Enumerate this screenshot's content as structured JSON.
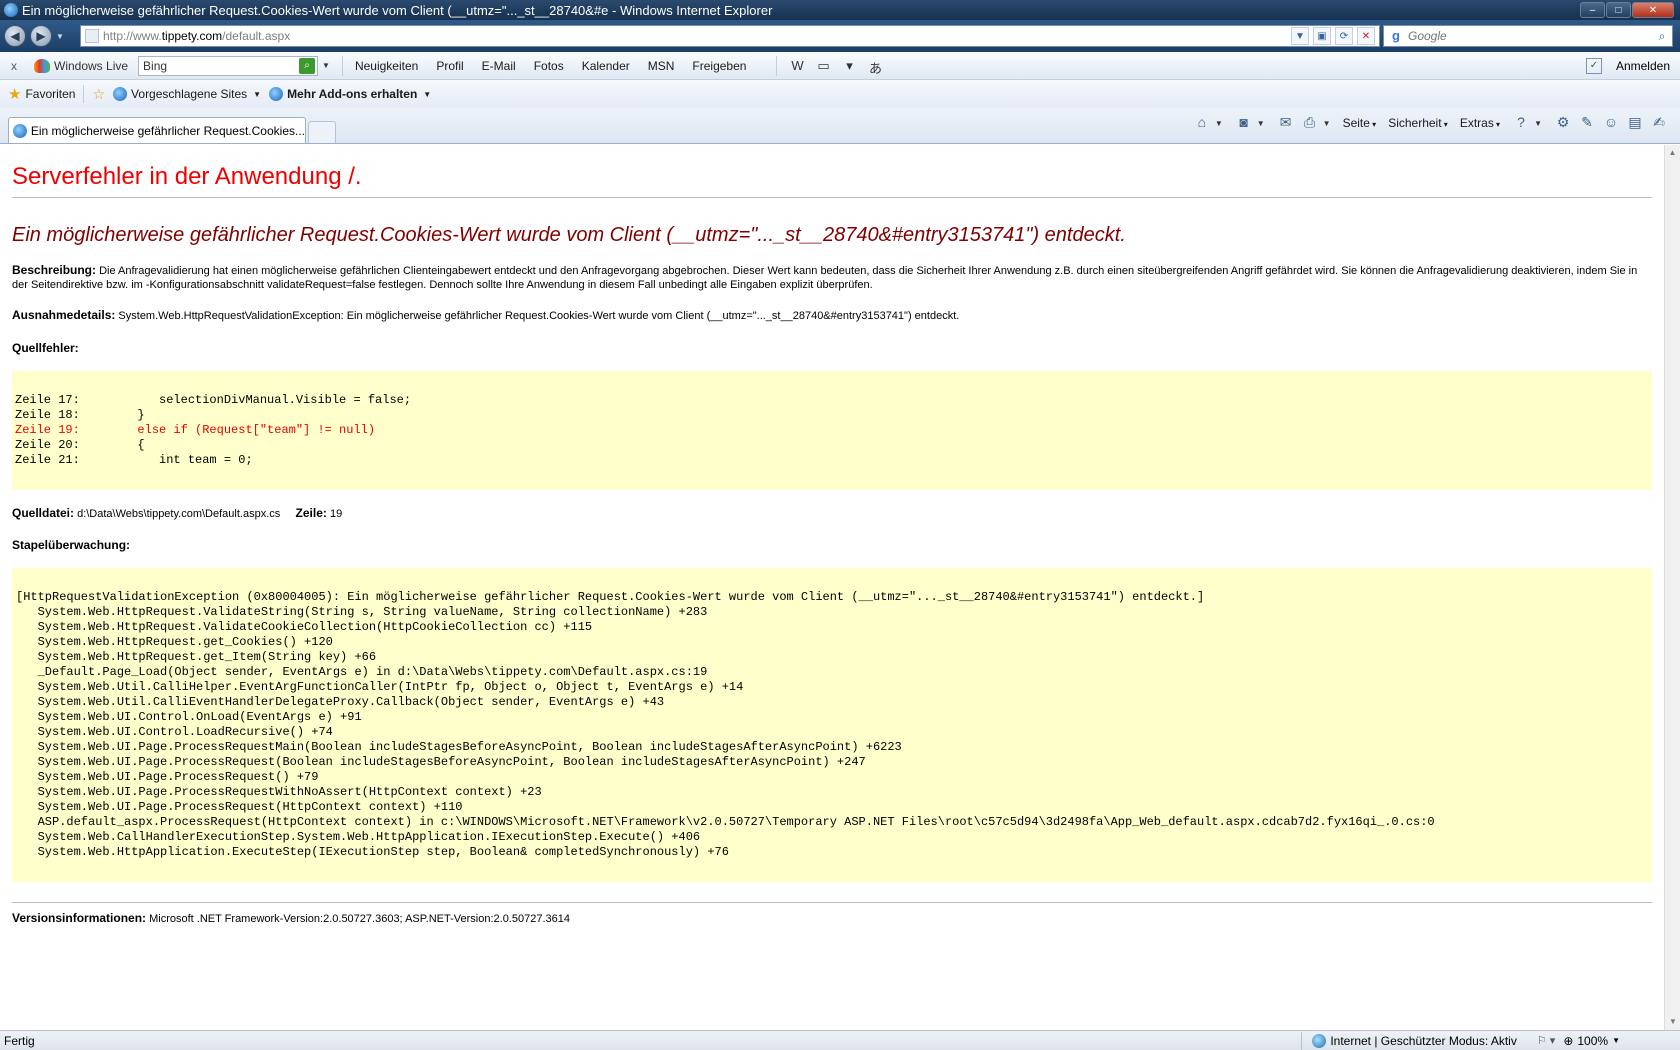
{
  "window": {
    "title": "Ein möglicherweise gefährlicher Request.Cookies-Wert wurde vom Client (__utmz=\"..._st__28740&#e - Windows Internet Explorer",
    "minimize": "–",
    "maximize": "□",
    "close": "✕"
  },
  "address_bar": {
    "url_prefix": "http://www.",
    "url_domain": "tippety.com",
    "url_path": "/default.aspx",
    "search_placeholder": "Google"
  },
  "live_toolbar": {
    "close": "x",
    "brand": "Windows Live",
    "bing_value": "Bing",
    "links": [
      "Neuigkeiten",
      "Profil",
      "E-Mail",
      "Fotos",
      "Kalender",
      "MSN",
      "Freigeben"
    ],
    "signin": "Anmelden"
  },
  "favorites_bar": {
    "favorites": "Favoriten",
    "suggested": "Vorgeschlagene Sites",
    "addons": "Mehr Add-ons erhalten"
  },
  "tab": {
    "label": "Ein möglicherweise gefährlicher Request.Cookies..."
  },
  "command_bar": {
    "menus": [
      "Seite",
      "Sicherheit",
      "Extras"
    ]
  },
  "page": {
    "heading": "Serverfehler in der Anwendung /.",
    "subheading": "Ein möglicherweise gefährlicher Request.Cookies-Wert wurde vom Client (__utmz=\"..._st__28740&#entry3153741\") entdeckt.",
    "description_label": "Beschreibung:",
    "description_text": "Die Anfragevalidierung hat einen möglicherweise gefährlichen Clienteingabewert entdeckt und den Anfragevorgang abgebrochen. Dieser Wert kann bedeuten, dass die Sicherheit Ihrer Anwendung z.B. durch einen siteübergreifenden Angriff gefährdet wird. Sie können die Anfragevalidierung deaktivieren, indem Sie in der Seitendirektive bzw. im -Konfigurationsabschnitt validateRequest=false festlegen. Dennoch sollte Ihre Anwendung in diesem Fall unbedingt alle Eingaben explizit überprüfen.",
    "exception_label": "Ausnahmedetails:",
    "exception_text": "System.Web.HttpRequestValidationException: Ein möglicherweise gefährlicher Request.Cookies-Wert wurde vom Client (__utmz=\"..._st__28740&#entry3153741\") entdeckt.",
    "source_error_label": "Quellfehler:",
    "source_lines": [
      "Zeile 17:           selectionDivManual.Visible = false;",
      "Zeile 18:        }",
      "Zeile 19:        else if (Request[\"team\"] != null)",
      "Zeile 20:        {",
      "Zeile 21:           int team = 0;"
    ],
    "source_file_label": "Quelldatei:",
    "source_file": "d:\\Data\\Webs\\tippety.com\\Default.aspx.cs",
    "line_label": "Zeile:",
    "line_number": "19",
    "stack_label": "Stapelüberwachung:",
    "stack_trace": "[HttpRequestValidationException (0x80004005): Ein möglicherweise gefährlicher Request.Cookies-Wert wurde vom Client (__utmz=\"..._st__28740&#entry3153741\") entdeckt.]\n   System.Web.HttpRequest.ValidateString(String s, String valueName, String collectionName) +283\n   System.Web.HttpRequest.ValidateCookieCollection(HttpCookieCollection cc) +115\n   System.Web.HttpRequest.get_Cookies() +120\n   System.Web.HttpRequest.get_Item(String key) +66\n   _Default.Page_Load(Object sender, EventArgs e) in d:\\Data\\Webs\\tippety.com\\Default.aspx.cs:19\n   System.Web.Util.CalliHelper.EventArgFunctionCaller(IntPtr fp, Object o, Object t, EventArgs e) +14\n   System.Web.Util.CalliEventHandlerDelegateProxy.Callback(Object sender, EventArgs e) +43\n   System.Web.UI.Control.OnLoad(EventArgs e) +91\n   System.Web.UI.Control.LoadRecursive() +74\n   System.Web.UI.Page.ProcessRequestMain(Boolean includeStagesBeforeAsyncPoint, Boolean includeStagesAfterAsyncPoint) +6223\n   System.Web.UI.Page.ProcessRequest(Boolean includeStagesBeforeAsyncPoint, Boolean includeStagesAfterAsyncPoint) +247\n   System.Web.UI.Page.ProcessRequest() +79\n   System.Web.UI.Page.ProcessRequestWithNoAssert(HttpContext context) +23\n   System.Web.UI.Page.ProcessRequest(HttpContext context) +110\n   ASP.default_aspx.ProcessRequest(HttpContext context) in c:\\WINDOWS\\Microsoft.NET\\Framework\\v2.0.50727\\Temporary ASP.NET Files\\root\\c57c5d94\\3d2498fa\\App_Web_default.aspx.cdcab7d2.fyx16qi_.0.cs:0\n   System.Web.CallHandlerExecutionStep.System.Web.HttpApplication.IExecutionStep.Execute() +406\n   System.Web.HttpApplication.ExecuteStep(IExecutionStep step, Boolean& completedSynchronously) +76",
    "version_label": "Versionsinformationen:",
    "version_text": "Microsoft .NET Framework-Version:2.0.50727.3603; ASP.NET-Version:2.0.50727.3614"
  },
  "status_bar": {
    "status": "Fertig",
    "zone": "Internet | Geschützter Modus: Aktiv",
    "zoom": "100%"
  }
}
